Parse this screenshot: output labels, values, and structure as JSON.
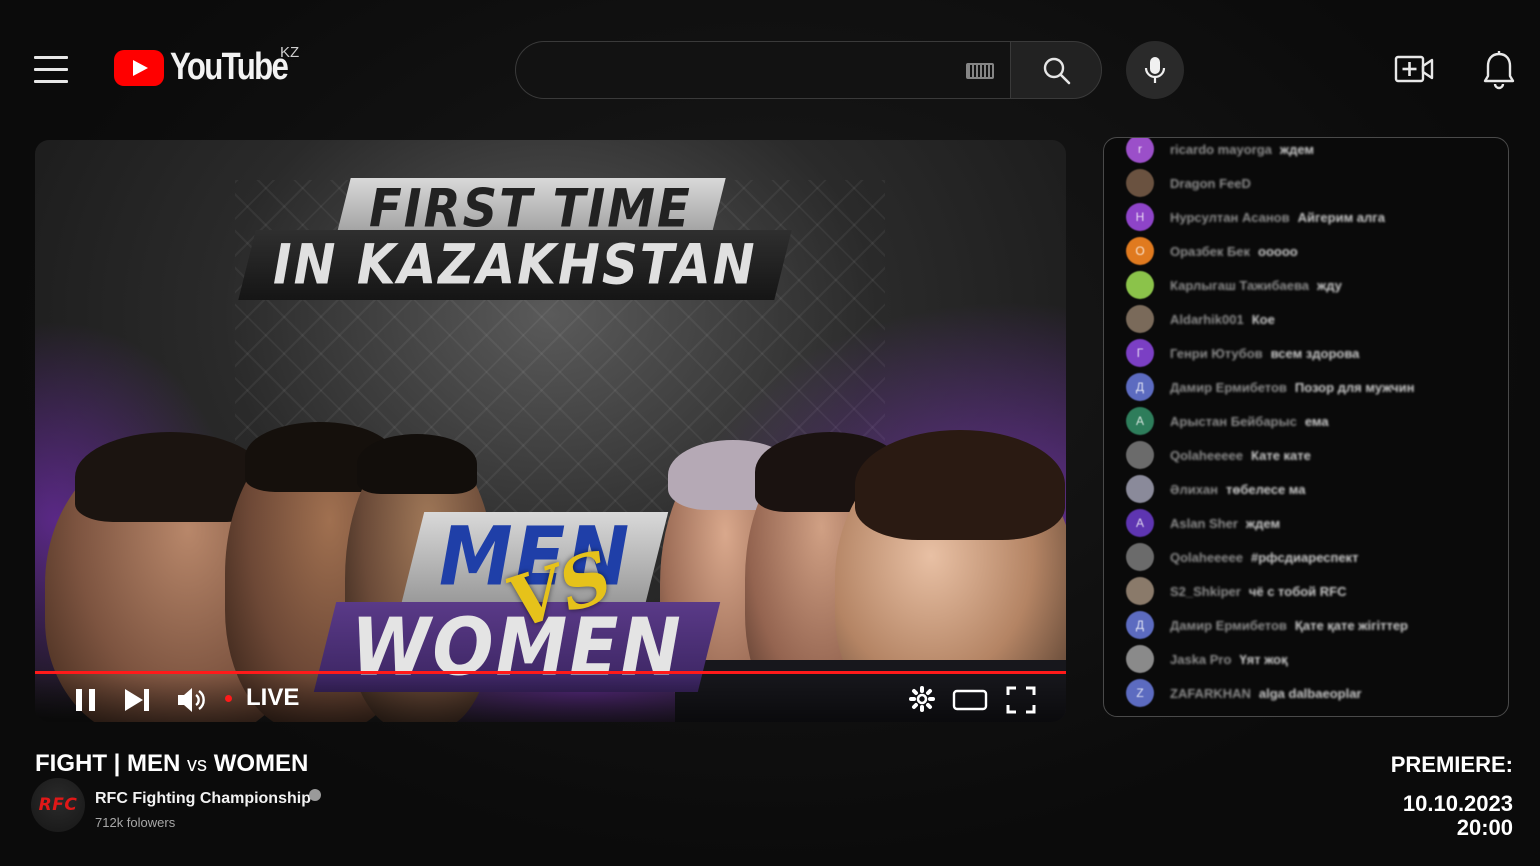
{
  "header": {
    "logo_text": "YouTube",
    "region": "KZ",
    "search_placeholder": ""
  },
  "player": {
    "thumbnail": {
      "line1": "FIRST TIME",
      "line2": "IN KAZAKHSTAN",
      "line3": "MEN",
      "vs": "VS",
      "line4": "WOMEN"
    },
    "live_label": "LIVE",
    "progress": 1.0
  },
  "chat": {
    "messages": [
      {
        "author": "ricardo mayorga",
        "text": "ждем",
        "initial": "r",
        "color": "#9b4fc9"
      },
      {
        "author": "Dragon FeeD",
        "text": "",
        "initial": "",
        "color": "#6a5240"
      },
      {
        "author": "Нурсултан Асанов",
        "text": "Айгерим алга",
        "initial": "Н",
        "color": "#8e44c8"
      },
      {
        "author": "Оразбек Бек",
        "text": "ооооо",
        "initial": "О",
        "color": "#e07a1f"
      },
      {
        "author": "Карлыгаш Тажибаева",
        "text": "жду",
        "initial": "",
        "color": "#8bc34a"
      },
      {
        "author": "Aldarhik001",
        "text": "Кое",
        "initial": "",
        "color": "#7a6a5a"
      },
      {
        "author": "Генри Ютубов",
        "text": "всем здорова",
        "initial": "Г",
        "color": "#7b3fc4"
      },
      {
        "author": "Дамир Ермибетов",
        "text": "Позор для мужчин",
        "initial": "Д",
        "color": "#5c6bc0"
      },
      {
        "author": "Арыстан Бейбарыс",
        "text": "ема",
        "initial": "А",
        "color": "#2e7d5b"
      },
      {
        "author": "Qolaheeeee",
        "text": "Кате кате",
        "initial": "",
        "color": "#6b6b6b"
      },
      {
        "author": "Әлихан",
        "text": "төбелесе ма",
        "initial": "",
        "color": "#8a8a9a"
      },
      {
        "author": "Aslan Sher",
        "text": "ждем",
        "initial": "A",
        "color": "#5e35b1"
      },
      {
        "author": "Qolaheeeee",
        "text": "#рфсдиареспект",
        "initial": "",
        "color": "#6b6b6b"
      },
      {
        "author": "S2_Shkiper",
        "text": "чё с тобой RFC",
        "initial": "",
        "color": "#8a7a6a"
      },
      {
        "author": "Дамир Ермибетов",
        "text": "Қате қате жігіттер",
        "initial": "Д",
        "color": "#5c6bc0"
      },
      {
        "author": "Jaska Pro",
        "text": "Үят жоқ",
        "initial": "",
        "color": "#8a8a8a"
      },
      {
        "author": "ZAFARKHAN",
        "text": "alga dalbaeoplar",
        "initial": "Z",
        "color": "#5c6bc0"
      }
    ]
  },
  "video": {
    "title_part1": "FIGHT | MEN",
    "title_vs": "vs",
    "title_part2": "WOMEN",
    "channel_name": "RFC Fighting Championship",
    "channel_logo": "RFC",
    "subscribers": "712k folowers"
  },
  "premiere": {
    "label": "PREMIERE:",
    "date": "10.10.2023",
    "time": "20:00"
  },
  "colors": {
    "accent": "#ff0000",
    "background": "#0d0d0d"
  }
}
